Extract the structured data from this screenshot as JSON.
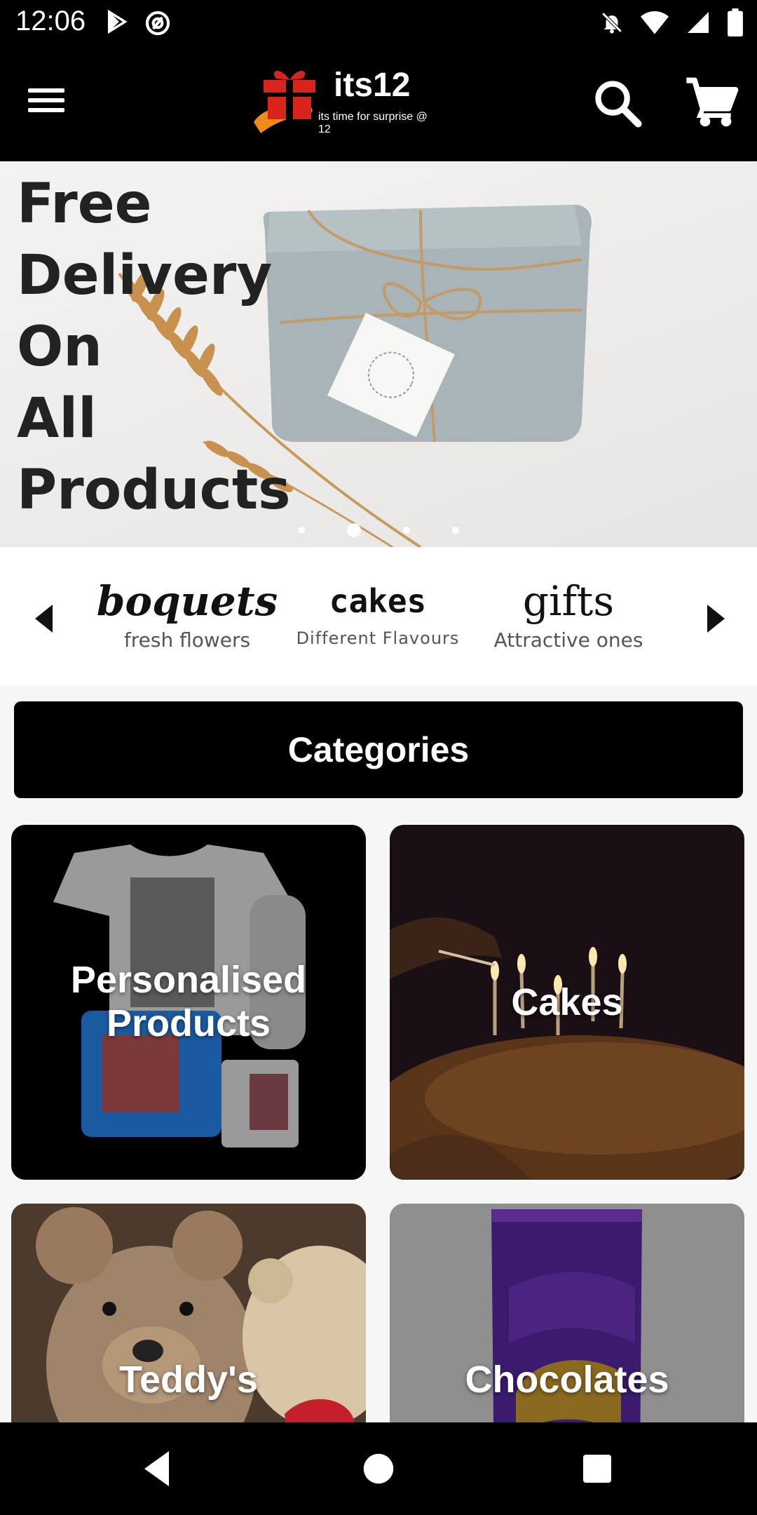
{
  "status_bar": {
    "time": "12:06",
    "left_icons": [
      "play-store-icon",
      "at-sign-icon"
    ],
    "right_icons": [
      "notifications-off-icon",
      "wifi-icon",
      "signal-icon",
      "battery-icon"
    ]
  },
  "app_bar": {
    "logo_title": "its12",
    "logo_tagline": "its time for surprise @ 12",
    "menu_icon": "menu-icon",
    "search_icon": "search-icon",
    "cart_icon": "cart-icon"
  },
  "banner": {
    "lines": [
      "Free",
      "Delivery",
      "On",
      "All",
      "Products"
    ],
    "slides": 4,
    "active_slide": 2
  },
  "strip": {
    "items": [
      {
        "title": "boquets",
        "subtitle": "fresh flowers"
      },
      {
        "title": "cakes",
        "subtitle": "Different Flavours"
      },
      {
        "title": "gifts",
        "subtitle": "Attractive ones"
      }
    ]
  },
  "categories": {
    "header": "Categories",
    "items": [
      {
        "label_line1": "Personalised",
        "label_line2": "Products"
      },
      {
        "label_line1": "Cakes"
      },
      {
        "label_line1": "Teddy's"
      },
      {
        "label_line1": "Chocolates"
      }
    ]
  },
  "colors": {
    "bar": "#000000",
    "accent_orange": "#f08a1c",
    "gift_red": "#d9241c"
  }
}
